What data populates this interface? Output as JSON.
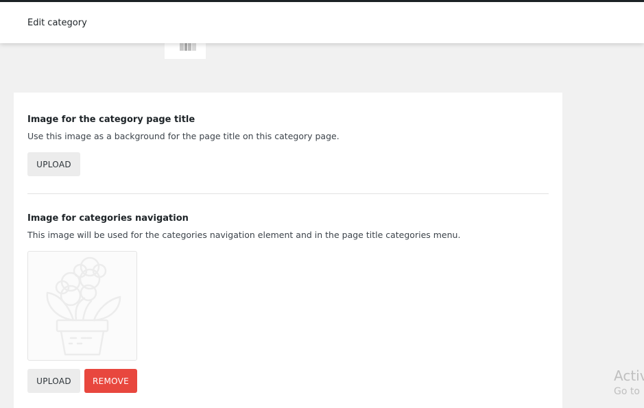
{
  "header": {
    "title": "Edit category"
  },
  "sections": [
    {
      "title": "Image for the category page title",
      "description": "Use this image as a background for the page title on this category page.",
      "upload_label": "UPLOAD"
    },
    {
      "title": "Image for categories navigation",
      "description": "This image will be used for the categories navigation element and in the page title categories menu.",
      "upload_label": "UPLOAD",
      "remove_label": "REMOVE",
      "preview_icon": "flower-pot-icon"
    }
  ],
  "watermark": {
    "line1": "Activ",
    "line2": "Go to"
  },
  "colors": {
    "remove_button": "#e8473e",
    "upload_button": "#ececec",
    "page_background": "#f1f1f1"
  }
}
